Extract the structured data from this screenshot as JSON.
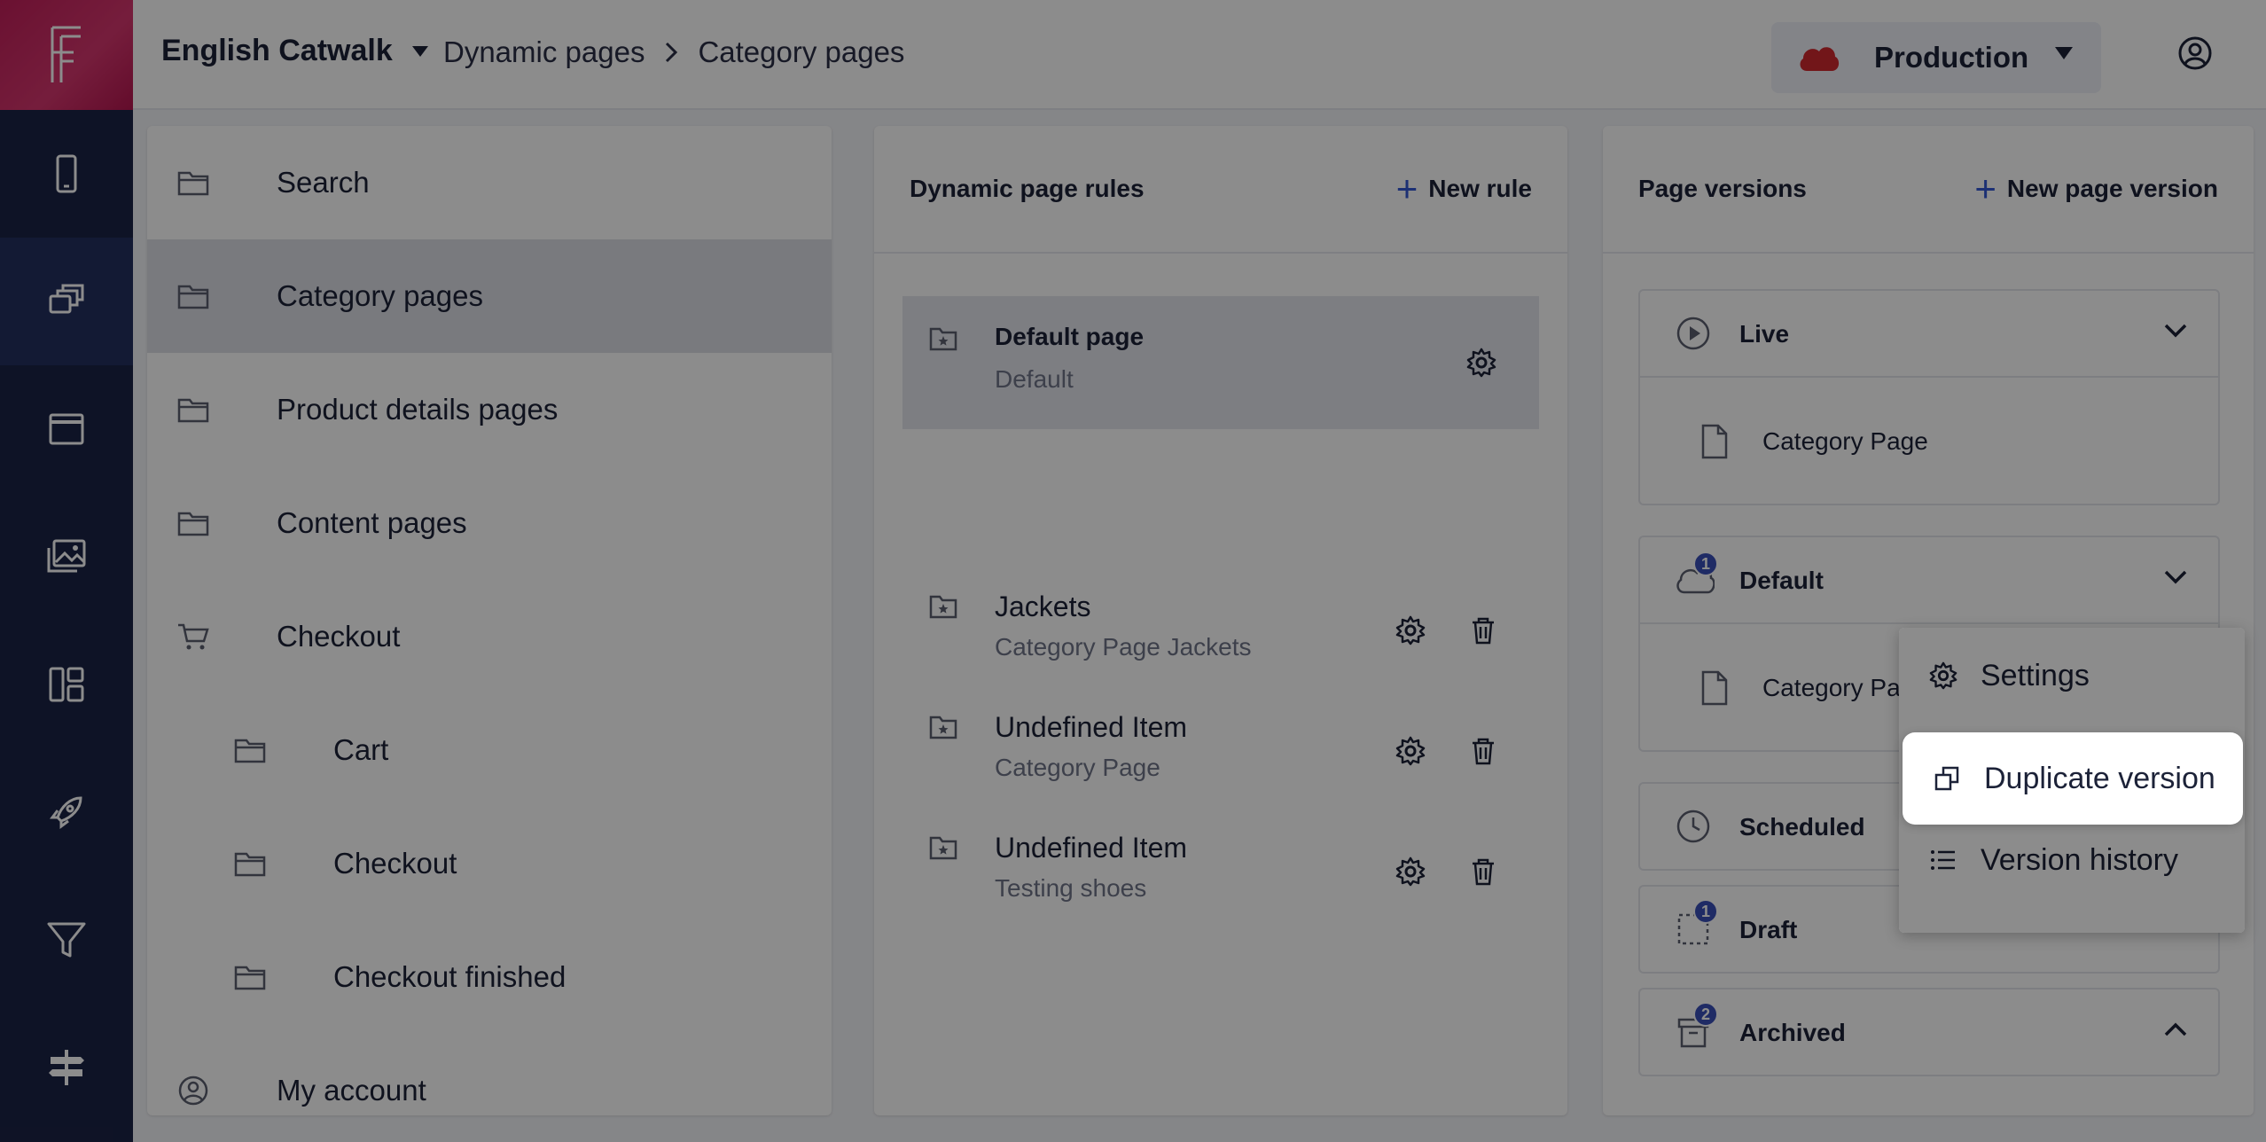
{
  "topbar": {
    "project": "English Catwalk",
    "breadcrumb": [
      "Dynamic pages",
      "Category pages"
    ],
    "environment": "Production"
  },
  "sidebar_nav": [
    {
      "label": "Search",
      "icon": "folder-icon"
    },
    {
      "label": "Category pages",
      "icon": "folder-icon",
      "active": true
    },
    {
      "label": "Product details pages",
      "icon": "folder-icon"
    },
    {
      "label": "Content pages",
      "icon": "folder-icon"
    },
    {
      "label": "Checkout",
      "icon": "cart-icon"
    },
    {
      "label": "Cart",
      "icon": "folder-icon",
      "sub": true
    },
    {
      "label": "Checkout",
      "icon": "folder-icon",
      "sub": true
    },
    {
      "label": "Checkout finished",
      "icon": "folder-icon",
      "sub": true
    },
    {
      "label": "My account",
      "icon": "user-circle-icon"
    }
  ],
  "rules_panel": {
    "title": "Dynamic page rules",
    "add_label": "New rule",
    "rules": [
      {
        "title": "Default page",
        "subtitle": "Default"
      },
      {
        "title": "Jackets",
        "subtitle": "Category Page Jackets"
      },
      {
        "title": "Undefined Item",
        "subtitle": "Category Page"
      },
      {
        "title": "Undefined Item",
        "subtitle": "Testing shoes"
      }
    ]
  },
  "versions_panel": {
    "title": "Page versions",
    "add_label": "New page version",
    "sections": {
      "live": {
        "title": "Live",
        "item": "Category Page"
      },
      "default": {
        "title": "Default",
        "badge": "1",
        "item": "Category Page"
      },
      "scheduled": {
        "title": "Scheduled"
      },
      "draft": {
        "title": "Draft",
        "badge": "1"
      },
      "archived": {
        "title": "Archived",
        "badge": "2"
      }
    }
  },
  "context_menu": {
    "settings": "Settings",
    "duplicate": "Duplicate version",
    "history": "Version history"
  },
  "colors": {
    "rail": "#1b2346",
    "brand": "#c21f5a",
    "accent": "#3358d4",
    "env_cloud": "#d0282f"
  }
}
